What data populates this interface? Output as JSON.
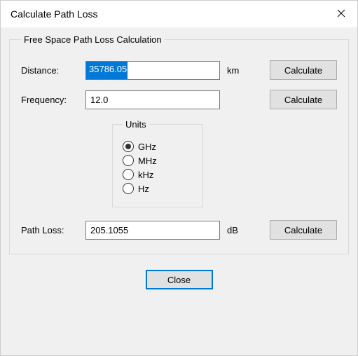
{
  "window": {
    "title": "Calculate Path Loss"
  },
  "group": {
    "legend": "Free Space Path Loss Calculation",
    "distance": {
      "label": "Distance:",
      "value": "35786.05",
      "unit": "km",
      "button": "Calculate"
    },
    "frequency": {
      "label": "Frequency:",
      "value": "12.0",
      "button": "Calculate"
    },
    "units": {
      "legend": "Units",
      "options": {
        "ghz": "GHz",
        "mhz": "MHz",
        "khz": "kHz",
        "hz": "Hz"
      },
      "selected": "ghz"
    },
    "pathloss": {
      "label": "Path Loss:",
      "value": "205.1055",
      "unit": "dB",
      "button": "Calculate"
    }
  },
  "footer": {
    "close": "Close"
  }
}
